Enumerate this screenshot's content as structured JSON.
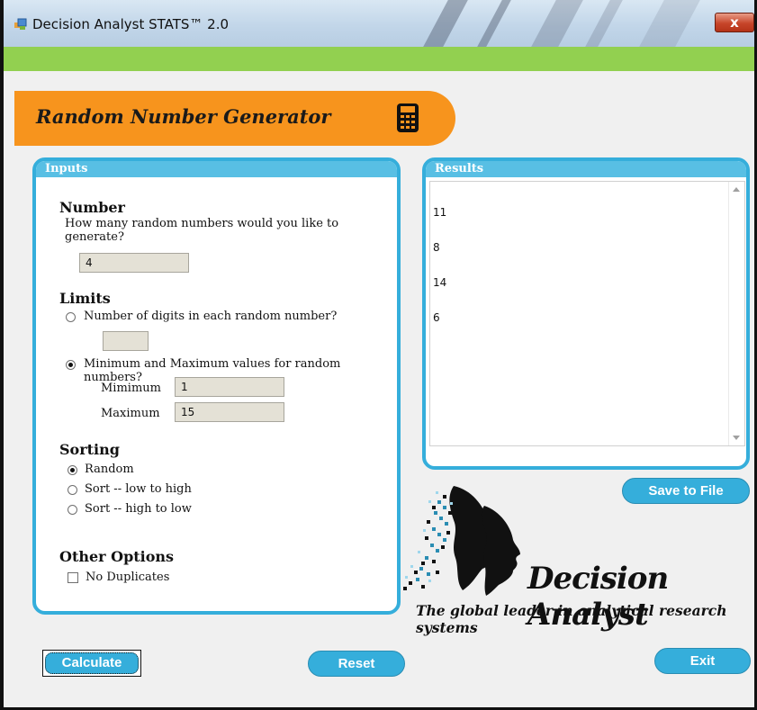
{
  "window": {
    "title": "Decision Analyst STATS™ 2.0",
    "close_glyph": "x"
  },
  "banner": {
    "title": "Random Number Generator",
    "icon": "calculator-icon"
  },
  "inputs": {
    "header": "Inputs",
    "number": {
      "title": "Number",
      "question_line1": "How many random numbers would you like to",
      "question_line2": "generate?",
      "value": "4"
    },
    "limits": {
      "title": "Limits",
      "option_digits": "Number of digits in each random number?",
      "digits_value": "",
      "option_minmax": "Minimum and Maximum values for random numbers?",
      "selected": "minmax",
      "minimum_label": "Mimimum",
      "minimum_value": "1",
      "maximum_label": "Maximum",
      "maximum_value": "15"
    },
    "sorting": {
      "title": "Sorting",
      "options": [
        "Random",
        "Sort -- low to high",
        "Sort -- high to low"
      ],
      "selected": "Random"
    },
    "other": {
      "title": "Other Options",
      "no_duplicates_label": "No Duplicates",
      "no_duplicates_checked": false
    }
  },
  "results": {
    "header": "Results",
    "values": [
      "11",
      "8",
      "14",
      "6"
    ]
  },
  "buttons": {
    "save": "Save to File",
    "calculate": "Calculate",
    "reset": "Reset",
    "exit": "Exit"
  },
  "branding": {
    "name": "Decision Analyst",
    "tagline": "The global leader in analytical research systems"
  },
  "colors": {
    "accent_blue": "#35aedb",
    "banner_orange": "#f7941d",
    "top_bar_green": "#92d050"
  }
}
